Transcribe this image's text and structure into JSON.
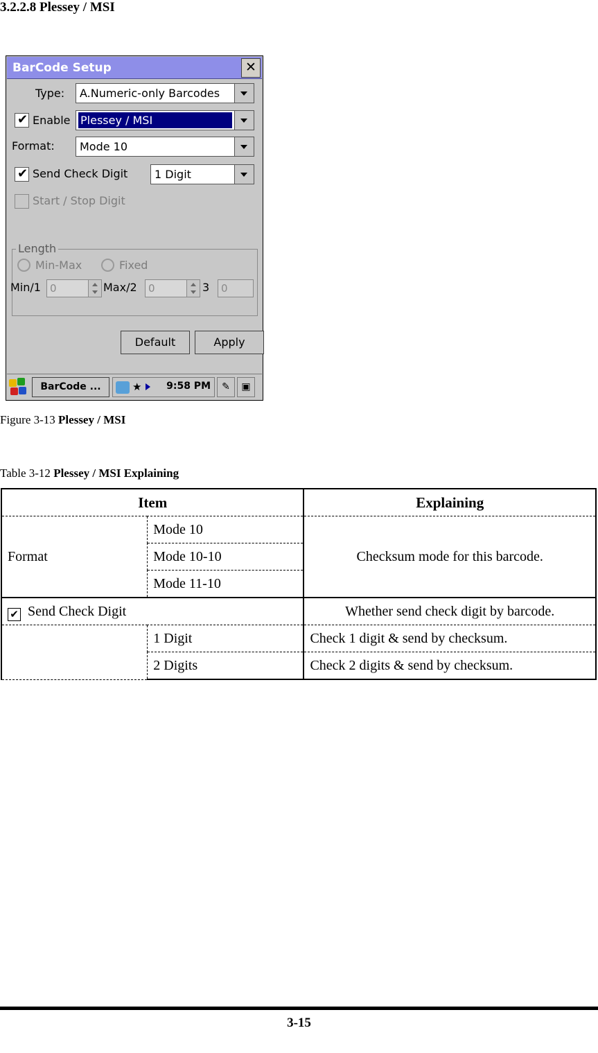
{
  "heading": "3.2.2.8 Plessey / MSI",
  "screenshot": {
    "window_title": "BarCode Setup",
    "close_label": "✕",
    "fields": {
      "type_label": "Type:",
      "type_value": "A.Numeric-only Barcodes",
      "enable_label": "Enable",
      "enable_checked_mark": "✔",
      "enable_value": "Plessey / MSI",
      "format_label": "Format:",
      "format_value": "Mode 10",
      "send_check_digit_label": "Send Check Digit",
      "send_check_digit_mark": "✔",
      "send_check_digit_value": "1 Digit",
      "start_stop_label": "Start / Stop Digit"
    },
    "length_group": {
      "title": "Length",
      "min_max_label": "Min-Max",
      "fixed_label": "Fixed",
      "min_label": "Min/1",
      "min_value": "0",
      "max_label": "Max/2",
      "max_value": "0",
      "third_label": "3",
      "third_value": "0"
    },
    "buttons": {
      "default_label": "Default",
      "apply_label": "Apply"
    },
    "taskbar": {
      "task_button": "BarCode ...",
      "time": "9:58 PM"
    }
  },
  "figure_caption": {
    "prefix": "Figure 3-13 ",
    "bold": "Plessey / MSI"
  },
  "table_caption": {
    "prefix": "Table 3-12 ",
    "bold": "Plessey / MSI Explaining"
  },
  "table": {
    "headers": {
      "item": "Item",
      "explaining": "Explaining"
    },
    "format_row_label": "Format",
    "format_options": [
      "Mode 10",
      "Mode 10-10",
      "Mode 11-10"
    ],
    "format_explaining": "Checksum mode for this barcode.",
    "send_check_digit": {
      "checkbox_mark": "✔",
      "label": "Send Check Digit",
      "explaining": "Whether send check digit by barcode."
    },
    "digit_rows": [
      {
        "option": "1 Digit",
        "explaining": "Check 1 digit & send by checksum."
      },
      {
        "option": "2 Digits",
        "explaining": "Check 2 digits & send by checksum."
      }
    ]
  },
  "footer": {
    "page_number": "3-15"
  }
}
